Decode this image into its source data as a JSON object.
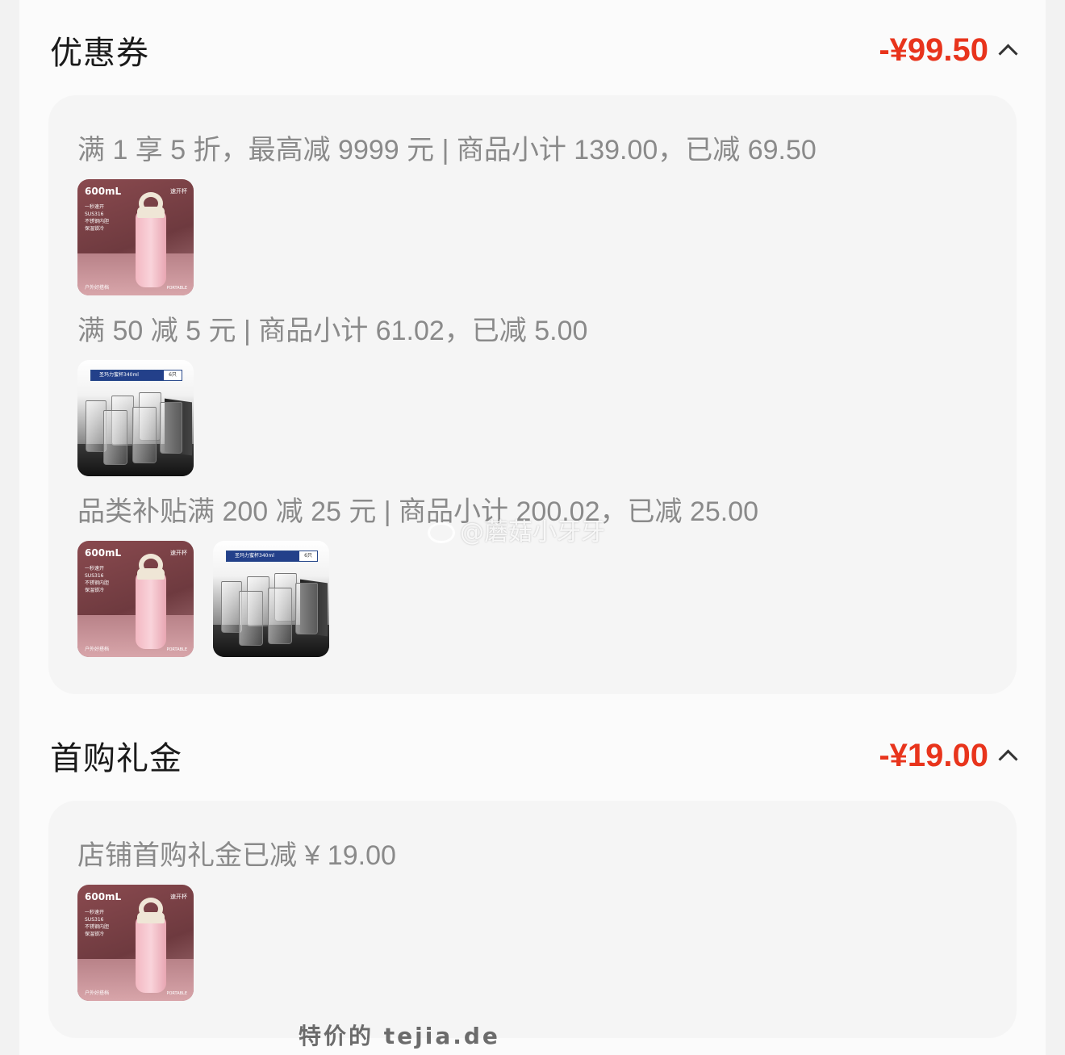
{
  "coupon": {
    "title": "优惠券",
    "amount": "-¥99.50",
    "rows": [
      {
        "text": "满 1 享 5 折，最高减 9999 元 | 商品小计 139.00，已减 69.50"
      },
      {
        "text": "满 50 减 5 元 | 商品小计 61.02，已减 5.00"
      },
      {
        "text": "品类补贴满 200 减 25 元 | 商品小计 200.02，已减 25.00"
      }
    ]
  },
  "first_purchase": {
    "title": "首购礼金",
    "amount": "-¥19.00",
    "rows": [
      {
        "text": "店铺首购礼金已减 ¥ 19.00"
      }
    ]
  },
  "products": {
    "bottle": {
      "volume": "600mL",
      "brand": "速开杯",
      "features": [
        "一秒速开",
        "SUS316",
        "不锈钢内胆",
        "保温锁冷"
      ],
      "footer_left": "户外好搭档",
      "footer_right": "PORTABLE"
    },
    "cups": {
      "banner": "圣玛力蜜杯340ml",
      "count": "6只"
    }
  },
  "watermarks": {
    "weibo": "@蘑菇小牙牙",
    "site": "特价的 tejia.de"
  },
  "colors": {
    "accent": "#e8341c",
    "card_bg": "#f5f5f5",
    "muted_text": "#8a8a8a"
  }
}
